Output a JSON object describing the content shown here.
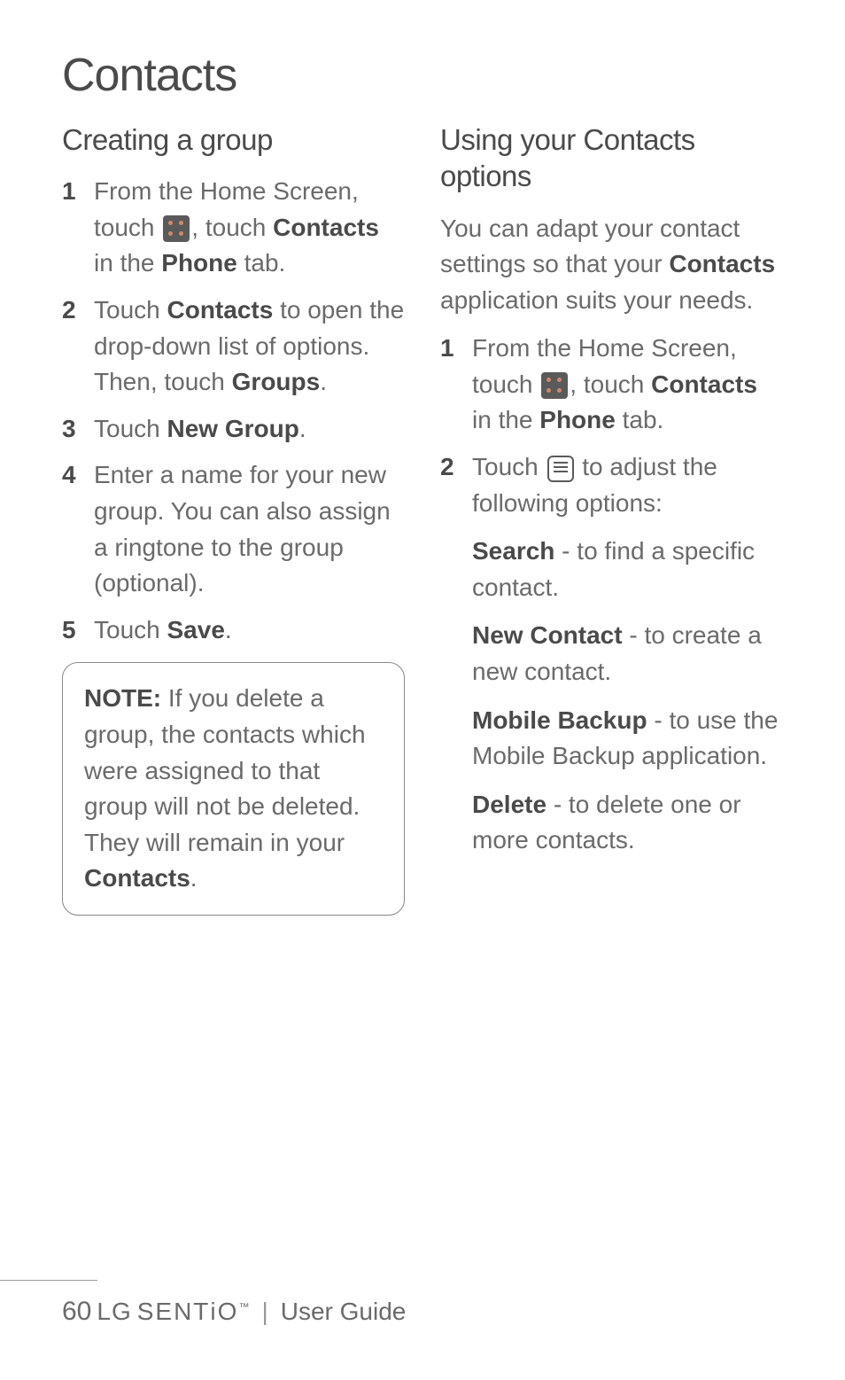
{
  "title": "Contacts",
  "left": {
    "heading": "Creating a group",
    "steps": [
      {
        "pre": "From the Home Screen, touch ",
        "mid": ", touch ",
        "bold1": "Contacts",
        "mid2": " in the ",
        "bold2": "Phone",
        "post": " tab."
      },
      {
        "pre": "Touch ",
        "bold1": "Contacts",
        "mid": " to open the drop-down list of options. Then, touch ",
        "bold2": "Groups",
        "post": "."
      },
      {
        "pre": "Touch ",
        "bold1": "New Group",
        "post": "."
      },
      {
        "pre": "Enter a name for your new group. You can also assign a ringtone to the group (optional)."
      },
      {
        "pre": "Touch ",
        "bold1": "Save",
        "post": "."
      }
    ],
    "note": {
      "label": "NOTE:",
      "text": " If you delete a group, the contacts which were assigned to that group will not be deleted. They will remain in your ",
      "bold": "Contacts",
      "post": "."
    }
  },
  "right": {
    "heading": "Using your Contacts options",
    "intro": {
      "pre": "You can adapt your contact settings so that your ",
      "bold": "Contacts",
      "post": " application suits your needs."
    },
    "steps": [
      {
        "pre": "From the Home Screen, touch ",
        "mid": ", touch ",
        "bold1": "Contacts",
        "mid2": " in the ",
        "bold2": "Phone",
        "post": " tab."
      },
      {
        "pre": "Touch ",
        "mid": " to adjust the following options:"
      }
    ],
    "options": [
      {
        "bold": "Search",
        "text": " - to find a specific contact."
      },
      {
        "bold": "New Contact",
        "text": " - to create a new contact."
      },
      {
        "bold": "Mobile Backup",
        "text": " - to use the Mobile Backup application."
      },
      {
        "bold": "Delete",
        "text": " - to delete one or more contacts."
      }
    ]
  },
  "footer": {
    "page": "60",
    "brand_lg": "LG",
    "brand_sentio_pre": "SENT",
    "brand_sentio_i": "i",
    "brand_sentio_post": "O",
    "tm": "™",
    "doc": "User Guide"
  }
}
